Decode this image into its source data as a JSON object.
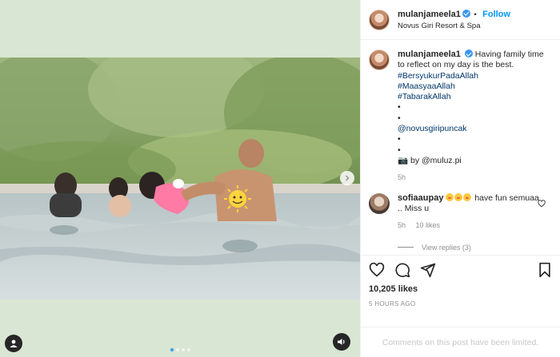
{
  "post": {
    "username": "mulanjameela1",
    "follow_label": "Follow",
    "follow_separator": "•",
    "location": "Novus Giri Resort & Spa"
  },
  "caption": {
    "username": "mulanjameela1",
    "text": "Having family time to reflect on my day is the best.",
    "lines": [
      "#BersyukurPadaAllah",
      "#MaasyaaAllah",
      "#TabarakAllah",
      "•",
      "•",
      "@novusgiripuncak",
      "•",
      "•"
    ],
    "credit": "📷 by @muluz.pi",
    "time": "5h"
  },
  "comment": {
    "username": "sofiaaupay",
    "text": "have fun semuaa .. Miss u",
    "time": "5h",
    "likes": "10 likes",
    "view_replies": "View replies (3)"
  },
  "stats": {
    "likes": "10,205 likes",
    "ago": "5 HOURS AGO"
  },
  "comments_status": "Comments on this post have been limited.",
  "carousel": {
    "count": 4,
    "active": 0
  },
  "icons": [
    "heart-icon",
    "comment-icon",
    "share-icon",
    "bookmark-icon",
    "user-tag-icon",
    "sound-icon",
    "chevron-right-icon"
  ],
  "colors": {
    "accent": "#0095f6",
    "link": "#00376b",
    "muted": "#8e8e8e"
  }
}
